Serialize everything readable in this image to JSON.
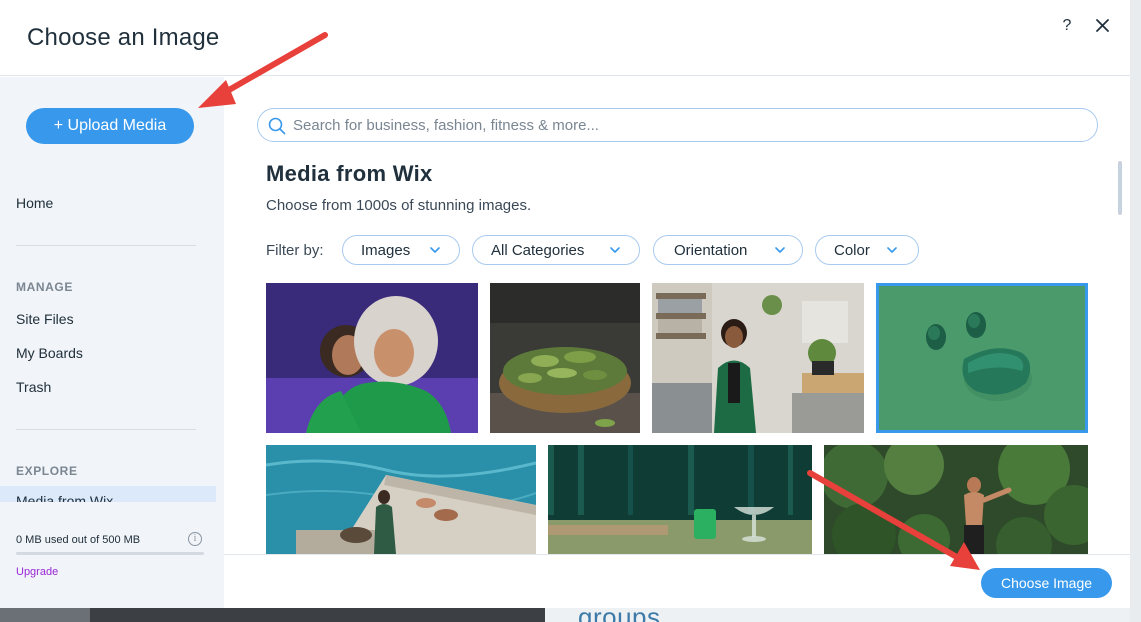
{
  "dialog": {
    "title": "Choose an Image",
    "help_label": "?"
  },
  "sidebar": {
    "upload_label": "+ Upload Media",
    "home_label": "Home",
    "manage_heading": "MANAGE",
    "manage_items": [
      "Site Files",
      "My Boards",
      "Trash"
    ],
    "explore_heading": "EXPLORE",
    "selected_item": "Media from Wix",
    "storage_text": "0 MB used out of 500 MB",
    "storage_used_fraction": 0,
    "info_label": "i",
    "upgrade_label": "Upgrade"
  },
  "main": {
    "search_placeholder": "Search for business, fashion, fitness & more...",
    "section_title": "Media from Wix",
    "section_subtitle": "Choose from 1000s of stunning images.",
    "filter_label": "Filter by:",
    "filters": [
      "Images",
      "All Categories",
      "Orientation",
      "Color"
    ]
  },
  "footer": {
    "choose_label": "Choose Image"
  },
  "background": {
    "groups_text": "groups"
  },
  "colors": {
    "accent": "#3899ec",
    "upgrade": "#9a27d5",
    "annotation_arrow": "#e8403a"
  },
  "images": [
    {
      "name": "two-people-green-outfits",
      "selected": false
    },
    {
      "name": "bowl-of-green-peppers",
      "selected": false
    },
    {
      "name": "woman-in-office",
      "selected": false
    },
    {
      "name": "green-earbuds",
      "selected": true
    },
    {
      "name": "people-on-pier-by-sea",
      "selected": false
    },
    {
      "name": "green-drinks-on-table",
      "selected": false
    },
    {
      "name": "woman-doing-yoga-in-jungle",
      "selected": false
    }
  ]
}
